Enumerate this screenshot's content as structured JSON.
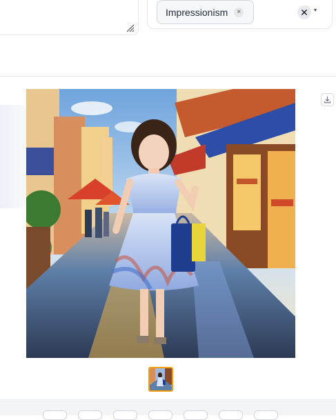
{
  "prompt_area": {
    "value": ""
  },
  "style_selector": {
    "selected_chip": "Impressionism",
    "chip_remove_glyph": "×",
    "clear_glyph": "✕",
    "caret_glyph": "▾"
  },
  "gallery": {
    "download_icon": "download-icon",
    "accent_color": "#f59e0b"
  }
}
